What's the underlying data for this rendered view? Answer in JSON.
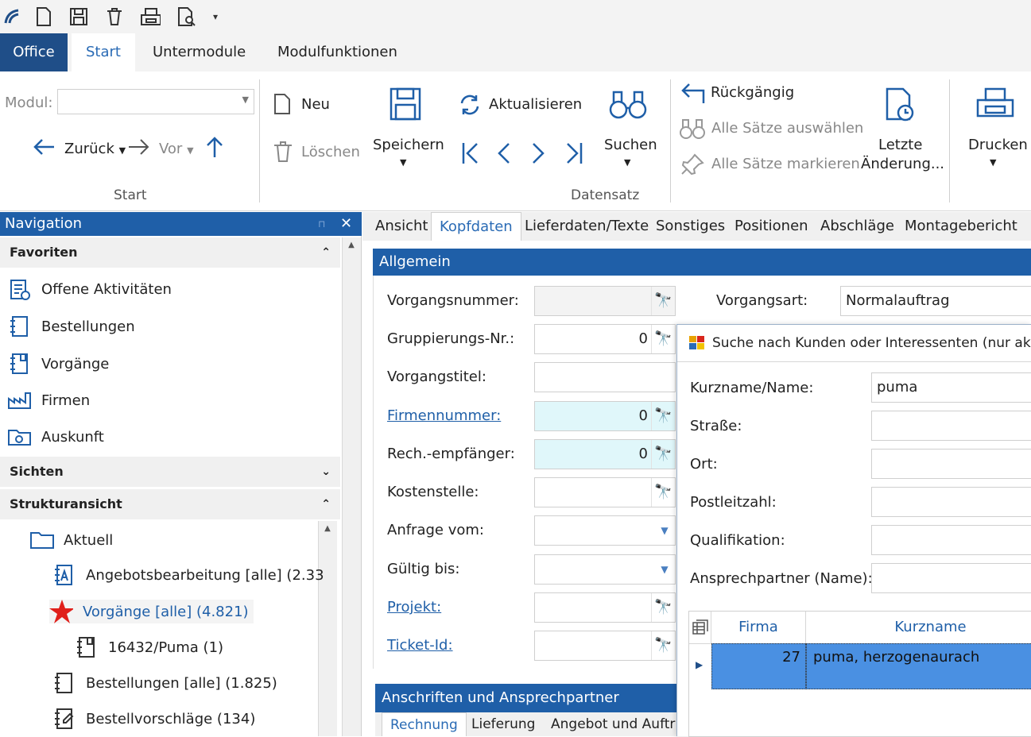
{
  "ribbon_tabs": {
    "office": "Office",
    "start": "Start",
    "untermodule": "Untermodule",
    "modulfunktionen": "Modulfunktionen"
  },
  "ribbon": {
    "modul_label": "Modul:",
    "zurueck": "Zurück",
    "vor": "Vor",
    "group_start": "Start",
    "neu": "Neu",
    "loeschen": "Löschen",
    "speichern": "Speichern",
    "aktualisieren": "Aktualisieren",
    "suchen": "Suchen",
    "rueckgaengig": "Rückgängig",
    "alle_auswaehlen": "Alle Sätze auswählen",
    "alle_markieren": "Alle Sätze markieren",
    "letzte_line1": "Letzte",
    "letzte_line2": "Änderung...",
    "drucken": "Drucken",
    "group_datensatz": "Datensatz"
  },
  "navigation": {
    "title": "Navigation",
    "favoriten": "Favoriten",
    "fav_items": [
      "Offene Aktivitäten",
      "Bestellungen",
      "Vorgänge",
      "Firmen",
      "Auskunft"
    ],
    "sichten": "Sichten",
    "strukturansicht": "Strukturansicht",
    "tree": {
      "aktuell": "Aktuell",
      "angebot": "Angebotsbearbeitung [alle] (2.33",
      "vorgaenge": "Vorgänge [alle] (4.821)",
      "puma": "16432/Puma (1)",
      "bestellungen": "Bestellungen [alle] (1.825)",
      "bestellvorschlaege": "Bestellvorschläge (134)"
    }
  },
  "main_tabs": [
    "Ansicht",
    "Kopfdaten",
    "Lieferdaten/Texte",
    "Sonstiges",
    "Positionen",
    "Abschläge",
    "Montagebericht"
  ],
  "allgemein": {
    "header": "Allgemein",
    "vorgangsnummer": "Vorgangsnummer:",
    "gruppierung": "Gruppierungs-Nr.:",
    "gruppierung_value": "0",
    "vorgangstitel": "Vorgangstitel:",
    "firmennummer": "Firmennummer:",
    "firmennummer_value": "0",
    "rechempfaenger": "Rech.-empfänger:",
    "rechempfaenger_value": "0",
    "kostenstelle": "Kostenstelle:",
    "anfrage": "Anfrage vom:",
    "gueltig": "Gültig bis:",
    "projekt": "Projekt:",
    "ticket": "Ticket-Id:",
    "vorgangsart": "Vorgangsart:",
    "vorgangsart_value": "Normalauftrag"
  },
  "anschriften": {
    "header": "Anschriften und Ansprechpartner",
    "tabs": [
      "Rechnung",
      "Lieferung",
      "Angebot und Auftr"
    ]
  },
  "dialog": {
    "title": "Suche nach Kunden oder Interessenten (nur aktive)",
    "kurzname_label": "Kurzname/Name:",
    "kurzname_value": "puma",
    "strasse": "Straße:",
    "ort": "Ort:",
    "plz": "Postleitzahl:",
    "qualifikation": "Qualifikation:",
    "ansprechpartner": "Ansprechpartner (Name):",
    "grid_headers": [
      "Firma",
      "Kurzname"
    ],
    "grid_row": {
      "firma": "27",
      "kurzname": "puma, herzogenaurach"
    }
  }
}
